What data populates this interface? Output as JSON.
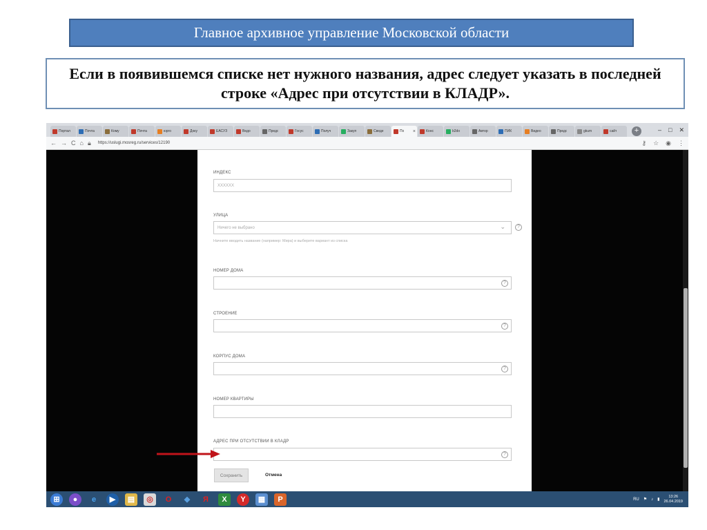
{
  "slide": {
    "header": "Главное архивное управление Московской области",
    "notice": "Если в появившемся списке нет нужного названия, адрес следует указать в последней строке «Адрес при отсутствии в КЛАДР»."
  },
  "browser": {
    "tabs": [
      {
        "label": "Портал",
        "color": "#c0392b"
      },
      {
        "label": "Почта",
        "color": "#2e6db4"
      },
      {
        "label": "Кому",
        "color": "#8a6d3b"
      },
      {
        "label": "Почта",
        "color": "#c0392b"
      },
      {
        "label": "юрго",
        "color": "#e67e22"
      },
      {
        "label": "Доку",
        "color": "#c0392b"
      },
      {
        "label": "ЕАСУЗ",
        "color": "#c0392b"
      },
      {
        "label": "Ведо",
        "color": "#c0392b"
      },
      {
        "label": "Предс",
        "color": "#666666"
      },
      {
        "label": "Госус",
        "color": "#c0392b"
      },
      {
        "label": "Получ",
        "color": "#2e6db4"
      },
      {
        "label": "Закуп",
        "color": "#27ae60"
      },
      {
        "label": "Сведе",
        "color": "#8a6d3b"
      },
      {
        "label": "По",
        "color": "#c0392b",
        "active": true
      },
      {
        "label": "Конс",
        "color": "#c0392b"
      },
      {
        "label": "b2do",
        "color": "#27ae60"
      },
      {
        "label": "Автор",
        "color": "#666666"
      },
      {
        "label": "ПИК",
        "color": "#2e6db4"
      },
      {
        "label": "Видео",
        "color": "#e67e22"
      },
      {
        "label": "Предс",
        "color": "#666666"
      },
      {
        "label": "gkum",
        "color": "#888888"
      },
      {
        "label": "сайт",
        "color": "#c0392b"
      }
    ],
    "url": "https://uslugi.mosreg.ru/services/12190"
  },
  "form": {
    "index": {
      "label": "ИНДЕКС",
      "value": "XXXXXX"
    },
    "street": {
      "label": "УЛИЦА",
      "value": "Ничего не выбрано",
      "hint": "Начните вводить название (например: Мира) и выберите вариант из списка"
    },
    "house": {
      "label": "НОМЕР ДОМА"
    },
    "building": {
      "label": "СТРОЕНИЕ"
    },
    "korpus": {
      "label": "КОРПУС ДОМА"
    },
    "apartment": {
      "label": "НОМЕР КВАРТИРЫ"
    },
    "kladr": {
      "label": "АДРЕС ПРИ ОТСУТСТВИИ В КЛАДР"
    },
    "save_label": "Сохранить",
    "cancel_label": "Отмена"
  },
  "taskbar": {
    "lang": "RU",
    "time": "13:26",
    "date": "26.04.2019"
  },
  "colors": {
    "banner": "#4f7fbd",
    "arrow": "#c0141a",
    "taskbar": "#2b4f73"
  }
}
